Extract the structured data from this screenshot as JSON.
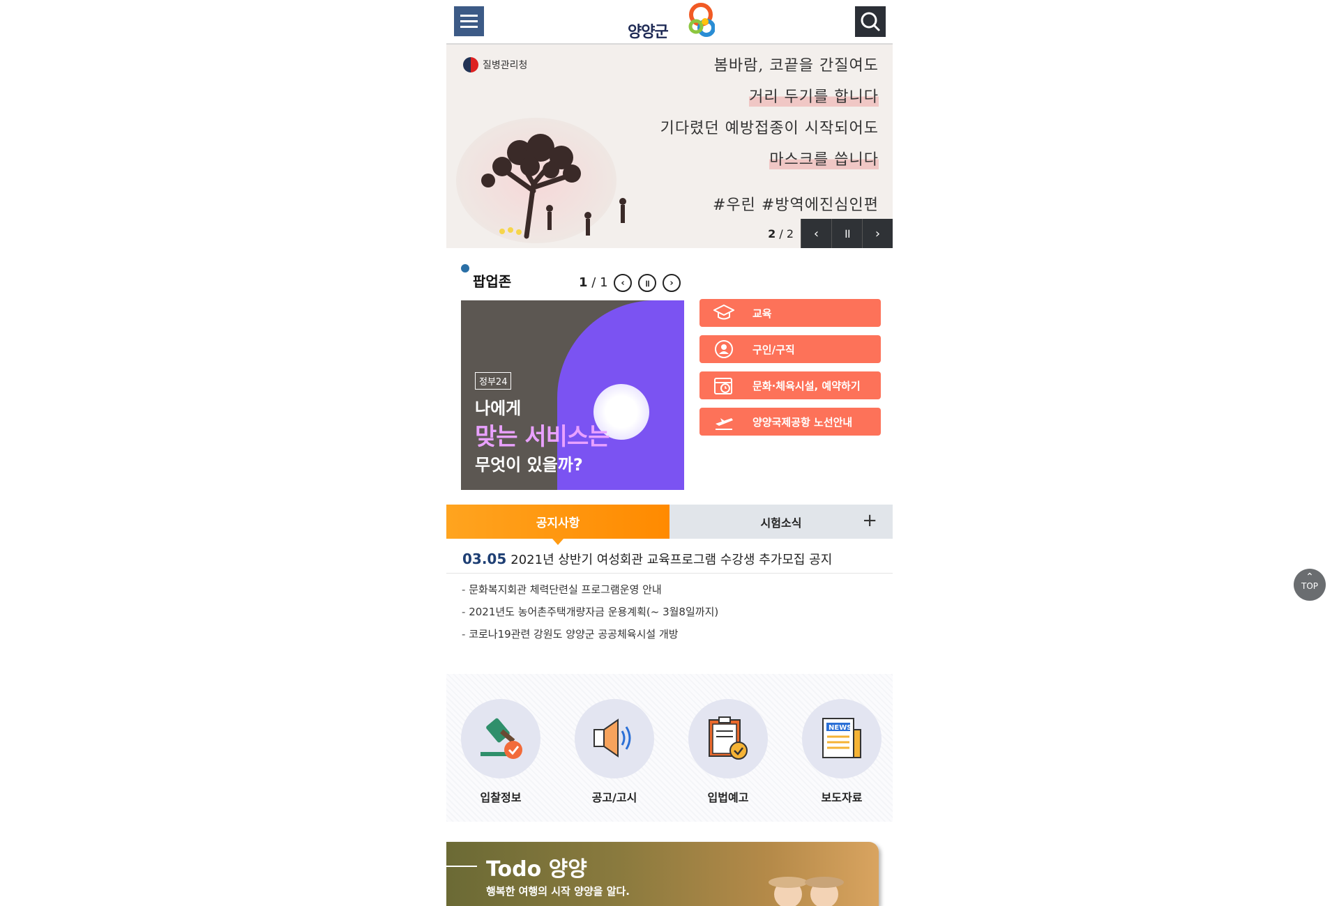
{
  "header": {
    "logo_text": "양양군"
  },
  "banner": {
    "agency": "질병관리청",
    "lines": [
      "봄바람, 코끝을 간질여도",
      "거리 두기를 합니다",
      "기다렸던 예방접종이 시작되어도",
      "마스크를 씁니다",
      "#우린 #방역에진심인편"
    ],
    "current": "2",
    "sep": "/",
    "total": "2",
    "prev_icon": "‹",
    "pause_icon": "॥",
    "next_icon": "›"
  },
  "popup_zone": {
    "title": "팝업존",
    "current": "1",
    "sep": "/",
    "total": "1",
    "image": {
      "tag": "정부24",
      "line1": "나에게",
      "line2": "맞는 서비스는",
      "line3": "무엇이 있을까?"
    }
  },
  "quick_links": [
    {
      "label": "교육",
      "icon": "graduation-cap-icon"
    },
    {
      "label": "구인/구직",
      "icon": "person-icon"
    },
    {
      "label": "문화·체육시설, 예약하기",
      "icon": "calendar-clock-icon"
    },
    {
      "label": "양양국제공항 노선안내",
      "icon": "airplane-icon"
    }
  ],
  "notice": {
    "tabs": [
      "공지사항",
      "시험소식"
    ],
    "more": "+",
    "top_date": "03.05",
    "top_title": "2021년 상반기 여성회관 교육프로그램 수강생 추가모집 공지",
    "items": [
      "문화복지회관 체력단련실 프로그램운영 안내",
      "2021년도 농어촌주택개량자금 운용계획(~ 3월8일까지)",
      "코로나19관련 강원도 양양군 공공체육시설 개방"
    ]
  },
  "shortcuts": [
    {
      "label": "입찰정보",
      "icon": "gavel-icon"
    },
    {
      "label": "공고/고시",
      "icon": "megaphone-icon"
    },
    {
      "label": "입법예고",
      "icon": "clipboard-check-icon"
    },
    {
      "label": "보도자료",
      "icon": "newspaper-icon"
    }
  ],
  "todo": {
    "title": "Todo 양양",
    "subtitle": "행복한 여행의 시작 양양을 알다."
  },
  "top_button": {
    "label": "TOP",
    "arrow": "⌃"
  },
  "colors": {
    "accent_orange": "#fd7259",
    "tab_orange": "#ff9a12",
    "navy": "#1e3f74",
    "menu_blue": "#3c5a86"
  }
}
